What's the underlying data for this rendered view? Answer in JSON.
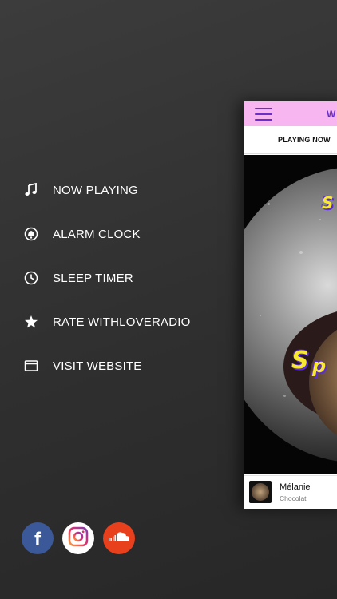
{
  "menu": {
    "items": [
      {
        "label": "NOW PLAYING",
        "icon": "music-note-icon"
      },
      {
        "label": "ALARM CLOCK",
        "icon": "alarm-bell-icon"
      },
      {
        "label": "SLEEP TIMER",
        "icon": "clock-icon"
      },
      {
        "label": "RATE WITHLOVERADIO",
        "icon": "star-icon"
      },
      {
        "label": "VISIT WEBSITE",
        "icon": "browser-window-icon"
      }
    ]
  },
  "social": [
    {
      "name": "facebook",
      "glyph": "f",
      "color": "#3b5998"
    },
    {
      "name": "instagram",
      "color": "#ffffff"
    },
    {
      "name": "soundcloud",
      "color": "#e8401c"
    }
  ],
  "panel": {
    "header_color": "#f7b6f0",
    "accent": "#6a2fc9",
    "brand_letter": "W",
    "tab_label": "PLAYING NOW",
    "now_playing": {
      "title": "Mélanie",
      "artist": "Chocolat"
    }
  }
}
